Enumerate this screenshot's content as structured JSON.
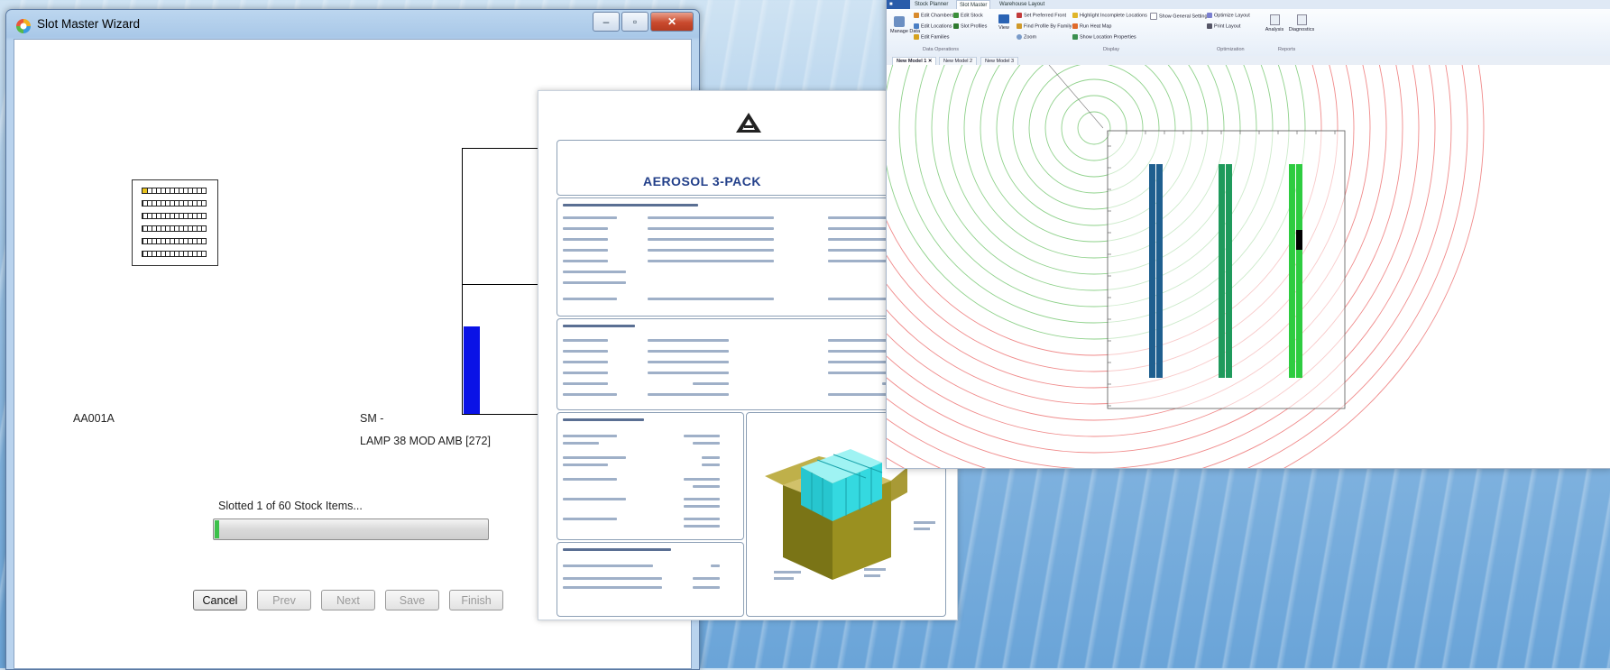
{
  "wizard": {
    "title": "Slot Master Wizard",
    "location_code": "AA001A",
    "sm_label": "SM -",
    "stock_item": "LAMP 38 MOD AMB [272]",
    "status": "Slotted 1 of 60 Stock Items...",
    "progress_fraction": 0.0167,
    "buttons": {
      "cancel": "Cancel",
      "prev": "Prev",
      "next": "Next",
      "save": "Save",
      "finish": "Finish"
    },
    "titlebar_icons": [
      "minimize-icon",
      "maximize-icon",
      "close-icon"
    ]
  },
  "report": {
    "title": "AEROSOL 3-PACK"
  },
  "analysis_app": {
    "tabs": [
      "Stock Planner",
      "Slot Master",
      "Warehouse Layout"
    ],
    "ribbon": {
      "manage_data": "Manage Data",
      "edit_chambers": "Edit Chambers",
      "edit_locations": "Edit Locations",
      "edit_families": "Edit Families",
      "edit_stock": "Edit Stock",
      "slot_profiles": "Slot Profiles",
      "data_group": "Data Operations",
      "view": "View",
      "set_preferred_front": "Set Preferred Front",
      "find_profile": "Find Profile By Family",
      "zoom": "Zoom",
      "highlight_incomplete": "Highlight Incomplete Locations",
      "run_heat_map": "Run Heat Map",
      "show_location_properties": "Show Location Properties",
      "show_general_settings": "Show General Settings",
      "display_group": "Display",
      "optimize_layout": "Optimize Layout",
      "print_layout": "Print Layout",
      "optimization_group": "Optimization",
      "analysis": "Analysis",
      "diagnostics": "Diagnostics",
      "reports_group": "Reports"
    },
    "doc_tabs": [
      "New Model 1",
      "New Model 2",
      "New Model 3"
    ],
    "colors": {
      "ring_green": "#8ed18a",
      "ring_red": "#f08a8a",
      "rack_blue": "#1f5f8f",
      "rack_teal": "#1f9a5c",
      "rack_green": "#2ecc40"
    }
  }
}
